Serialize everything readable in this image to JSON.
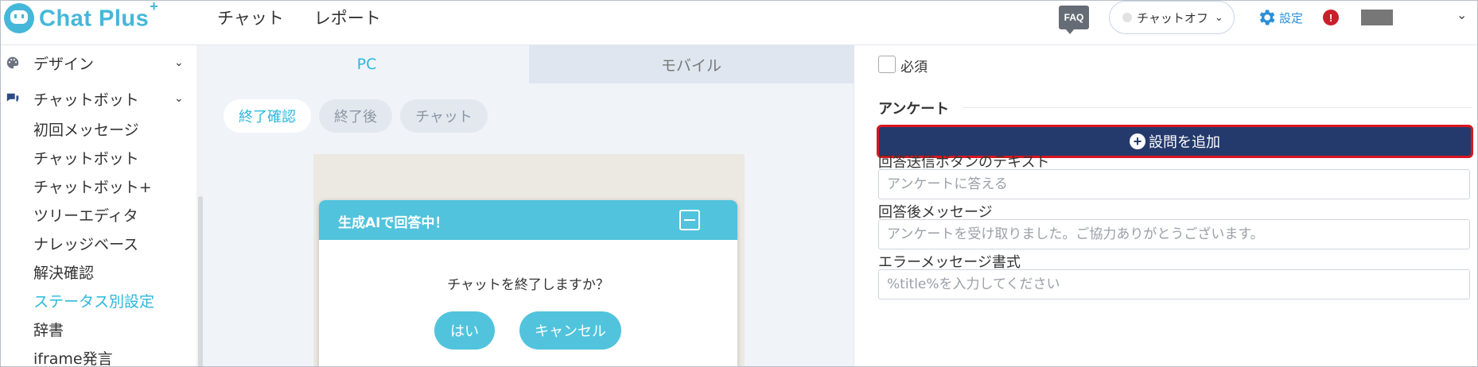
{
  "header": {
    "logo_text": "Chat Plus",
    "logo_sup": "+",
    "nav": [
      "チャット",
      "レポート"
    ],
    "faq_label": "FAQ",
    "status_label": "チャットオフ",
    "settings_label": "設定",
    "alert_glyph": "!"
  },
  "sidebar": {
    "sections": [
      {
        "label": "デザイン",
        "icon": "palette-icon"
      },
      {
        "label": "チャットボット",
        "icon": "chat-bubbles-icon"
      }
    ],
    "items": [
      "初回メッセージ",
      "チャットボット",
      "チャットボット+",
      "ツリーエディタ",
      "ナレッジベース",
      "解決確認",
      "ステータス別設定",
      "辞書",
      "iframe発言"
    ],
    "active_item": "ステータス別設定"
  },
  "preview": {
    "tabs": [
      "PC",
      "モバイル"
    ],
    "active_tab": "PC",
    "pills": [
      "終了確認",
      "終了後",
      "チャット"
    ],
    "active_pill": "終了確認",
    "chat_title": "生成AIで回答中！",
    "question": "チャットを終了しますか？",
    "yes_label": "はい",
    "cancel_label": "キャンセル"
  },
  "form": {
    "required_label": "必須",
    "section_title": "アンケート",
    "add_question_label": "設問を追加",
    "fields": [
      {
        "label": "回答送信ボタンのテキスト",
        "placeholder": "アンケートに答える"
      },
      {
        "label": "回答後メッセージ",
        "placeholder": "アンケートを受け取りました。ご協力ありがとうございます。"
      },
      {
        "label": "エラーメッセージ書式",
        "placeholder": "%title%を入力してください"
      }
    ]
  },
  "colors": {
    "brand": "#45b7d9",
    "accent": "#2bb7dd",
    "primary_button": "#253a6c",
    "highlight_border": "#d8161f",
    "chat_header": "#52c3dd"
  }
}
